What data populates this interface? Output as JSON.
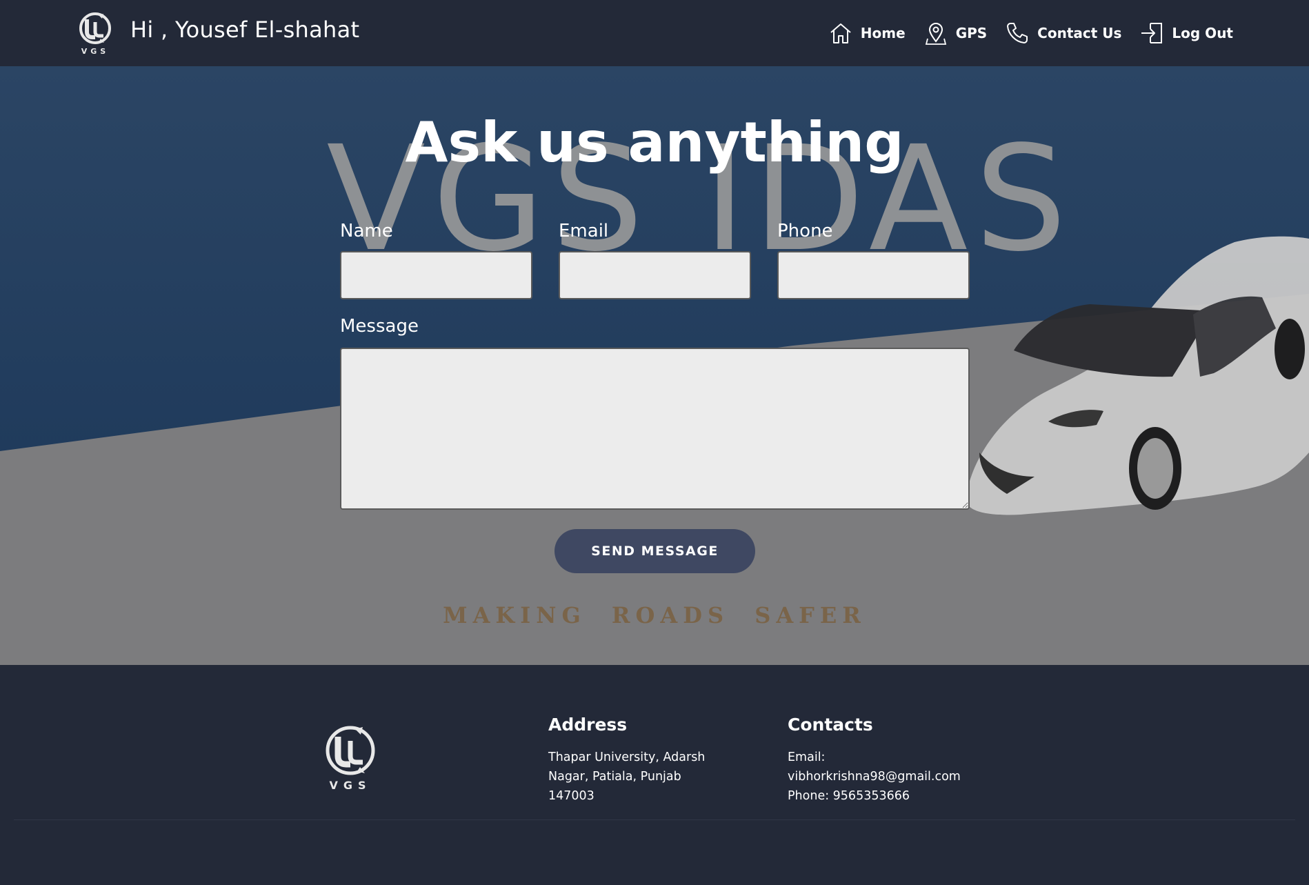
{
  "header": {
    "greeting": "Hi , Yousef El-shahat",
    "logo_text": "VGS",
    "nav": [
      {
        "label": "Home",
        "icon": "home-icon"
      },
      {
        "label": "GPS",
        "icon": "map-pin-icon"
      },
      {
        "label": "Contact Us",
        "icon": "phone-icon"
      },
      {
        "label": "Log Out",
        "icon": "logout-icon"
      }
    ]
  },
  "hero": {
    "title": "Ask us anything",
    "background_watermark": "VGS IDAS",
    "form": {
      "name_label": "Name",
      "name_value": "",
      "email_label": "Email",
      "email_value": "",
      "phone_label": "Phone",
      "phone_value": "",
      "message_label": "Message",
      "message_value": "",
      "submit_label": "SEND MESSAGE"
    },
    "tagline": "MAKING ROADS SAFER"
  },
  "footer": {
    "logo_text": "VGS",
    "address_title": "Address",
    "address_lines": [
      "Thapar University, Adarsh",
      "Nagar, Patiala, Punjab",
      "147003"
    ],
    "contacts_title": "Contacts",
    "contact_lines": [
      "Email:",
      "vibhorkrishna98@gmail.com",
      "Phone: 9565353666"
    ]
  },
  "colors": {
    "header_bg": "#232938",
    "hero_blue": "#27405f",
    "hero_gray": "#7c7c7e",
    "button_bg": "#3f4862",
    "tagline": "#7a6449"
  }
}
